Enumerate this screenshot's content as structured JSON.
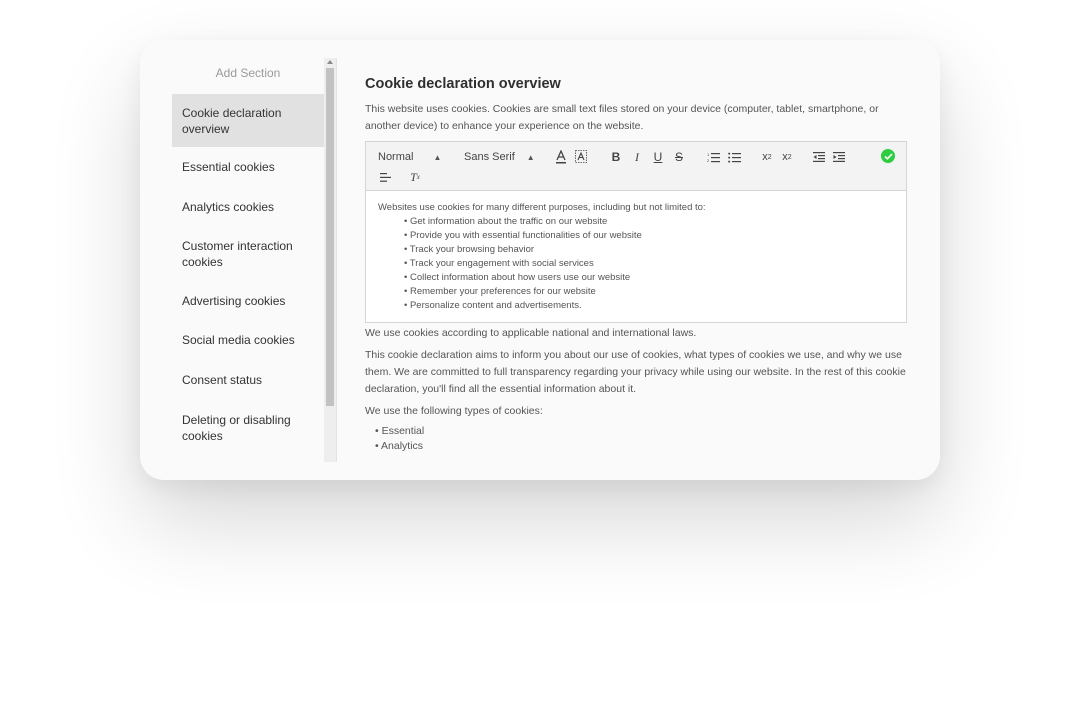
{
  "sidebar": {
    "add_section": "Add Section",
    "items": [
      {
        "label": "Cookie declaration overview",
        "active": true
      },
      {
        "label": "Essential cookies"
      },
      {
        "label": "Analytics cookies"
      },
      {
        "label": "Customer interaction cookies"
      },
      {
        "label": "Advertising cookies"
      },
      {
        "label": "Social media cookies"
      },
      {
        "label": "Consent status"
      },
      {
        "label": "Deleting or disabling cookies"
      }
    ]
  },
  "main": {
    "title": "Cookie declaration overview",
    "intro": "This website uses cookies. Cookies are small text files stored on your device (computer, tablet, smartphone, or another device) to enhance your experience on the website.",
    "toolbar": {
      "format_select": "Normal",
      "font_select": "Sans Serif",
      "icons": [
        "font-color-icon",
        "background-color-icon",
        "bold-icon",
        "italic-icon",
        "underline-icon",
        "strikethrough-icon",
        "ordered-list-icon",
        "bullet-list-icon",
        "subscript-icon",
        "superscript-icon",
        "outdent-icon",
        "indent-icon",
        "align-icon",
        "clear-format-icon",
        "check-icon"
      ],
      "accent_color": "#2ecc40"
    },
    "editor": {
      "intro": "Websites use cookies for many different purposes, including but not limited to:",
      "items": [
        "Get information about the traffic on our website",
        "Provide you with essential functionalities of our website",
        "Track your browsing behavior",
        "Track your engagement with social services",
        "Collect information about how users use our website",
        "Remember your preferences for our website",
        "Personalize content and advertisements."
      ]
    },
    "laws": "We use cookies according to applicable national and international laws.",
    "declaration": "This cookie declaration aims to inform you about our use of cookies, what types of cookies we use, and why we use them. We are committed to full transparency regarding your privacy while using our website. In the rest of this cookie declaration, you'll find all the essential information about it.",
    "types_intro": "We use the following types of cookies:",
    "types": [
      "Essential",
      "Analytics"
    ]
  }
}
